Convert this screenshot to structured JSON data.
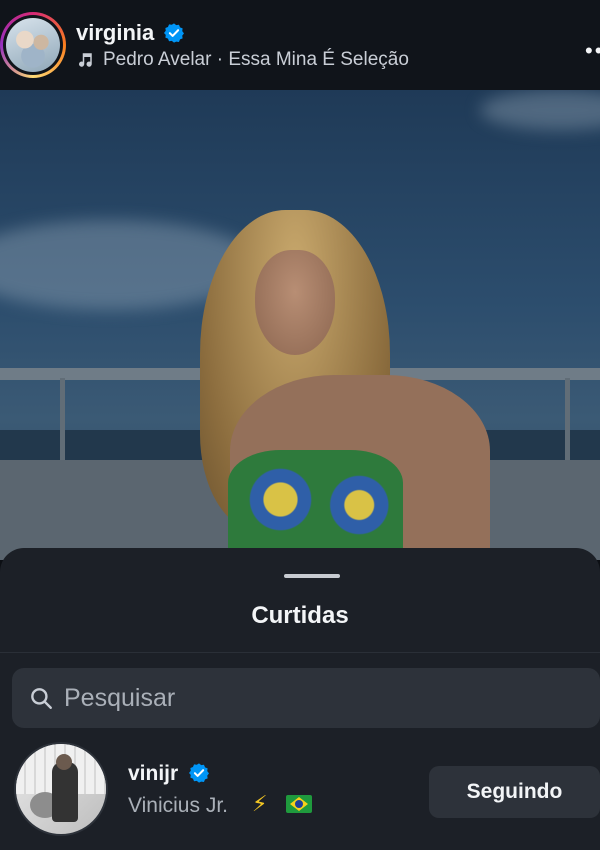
{
  "post_header": {
    "username": "virginia",
    "music_text": "Pedro Avelar · Essa Mina É Seleção",
    "icons": {
      "verified": "verified-badge-icon",
      "music": "music-note-icon",
      "more": "more-options-icon"
    }
  },
  "sheet": {
    "title": "Curtidas",
    "search": {
      "placeholder": "Pesquisar",
      "value": ""
    }
  },
  "likes": [
    {
      "handle": "vinijr",
      "full_name": "Vinicius Jr.",
      "follow_label": "Seguindo",
      "verified": true
    }
  ],
  "colors": {
    "background": "#10141a",
    "sheet": "#1c2027",
    "search_field": "#2d323a",
    "verified_blue": "#0095f6"
  }
}
